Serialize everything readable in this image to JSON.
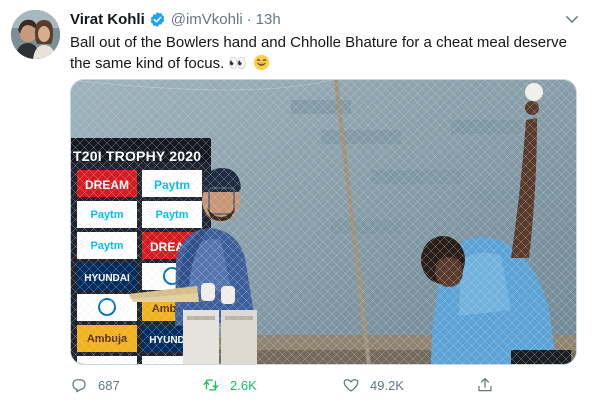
{
  "tweet": {
    "author_name": "Virat Kohli",
    "handle": "@imVkohli",
    "separator": "·",
    "time": "13h",
    "text": "Ball out of the Bowlers hand and Chholle Bhature for a cheat meal deserve the same kind of focus. 👀",
    "verified": true
  },
  "media": {
    "board_title": "T20I TROPHY 2020",
    "sponsor_tiles": [
      "DREAM11",
      "Paytm",
      "Paytm payments bank",
      "DREAM11",
      "HYUNDAI",
      "Ambuja Cement",
      "HYUNDAI",
      "Paytm"
    ]
  },
  "actions": {
    "replies": "687",
    "retweets": "2.6K",
    "likes": "49.2K"
  },
  "icons": [
    "verified-badge-icon",
    "chevron-down-icon",
    "reply-icon",
    "retweet-icon",
    "like-icon",
    "share-icon",
    "grinning-emoji-icon"
  ],
  "colors": {
    "text": "#14171a",
    "secondary": "#657786",
    "verified": "#1da1f2",
    "retweet_active": "#17bf63",
    "border": "#ccd6dd"
  }
}
